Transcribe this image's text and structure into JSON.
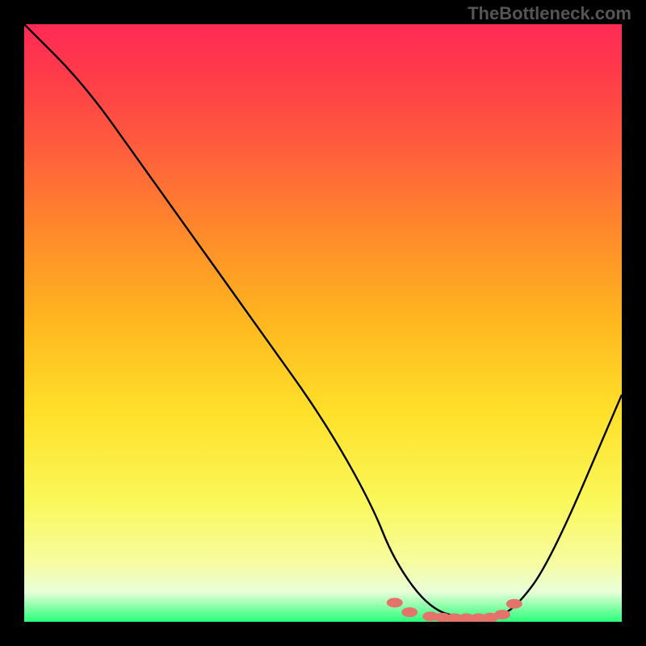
{
  "attribution": "TheBottleneck.com",
  "chart_data": {
    "type": "line",
    "title": "",
    "xlabel": "",
    "ylabel": "",
    "xlim": [
      0,
      100
    ],
    "ylim": [
      0,
      100
    ],
    "series": [
      {
        "name": "curve",
        "x": [
          0,
          10,
          20,
          30,
          40,
          50,
          58,
          62,
          68,
          74,
          78,
          82,
          88,
          100
        ],
        "y": [
          100,
          90,
          76,
          62,
          48,
          34,
          20,
          10,
          2,
          0.5,
          0.5,
          2,
          10,
          38
        ]
      }
    ],
    "markers": {
      "name": "highlight-points",
      "x": [
        62,
        64.5,
        68,
        70,
        72,
        74,
        76,
        78,
        80,
        82
      ],
      "y": [
        3.2,
        1.6,
        0.9,
        0.7,
        0.6,
        0.6,
        0.6,
        0.7,
        1.2,
        3.0
      ]
    },
    "background_gradient": {
      "top": "#ff2a55",
      "mid": "#ffe02a",
      "bottom": "#2aff7a"
    }
  }
}
